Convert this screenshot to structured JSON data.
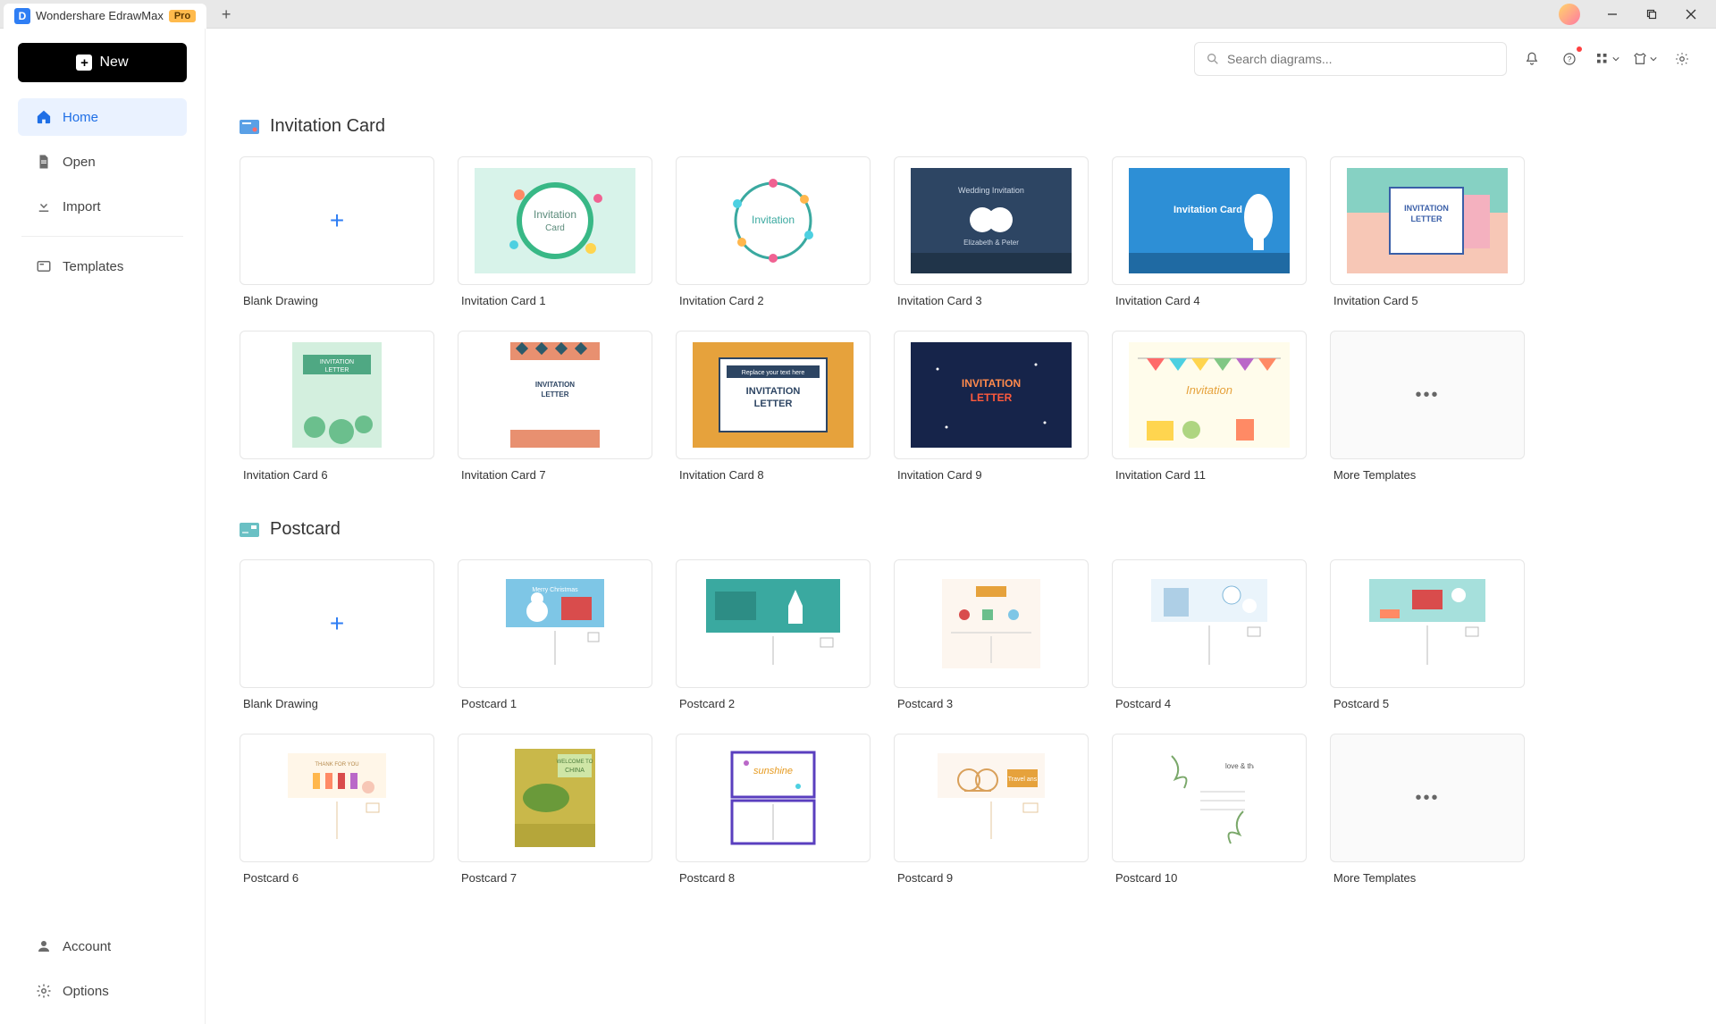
{
  "app": {
    "name": "Wondershare EdrawMax",
    "badge": "Pro"
  },
  "sidebar": {
    "new_label": "New",
    "items": [
      {
        "label": "Home"
      },
      {
        "label": "Open"
      },
      {
        "label": "Import"
      },
      {
        "label": "Templates"
      }
    ],
    "footer": [
      {
        "label": "Account"
      },
      {
        "label": "Options"
      }
    ]
  },
  "search": {
    "placeholder": "Search diagrams..."
  },
  "sections": [
    {
      "title": "Invitation Card",
      "cards": [
        {
          "label": "Blank Drawing"
        },
        {
          "label": "Invitation Card 1"
        },
        {
          "label": "Invitation Card 2"
        },
        {
          "label": "Invitation Card 3"
        },
        {
          "label": "Invitation Card 4"
        },
        {
          "label": "Invitation Card 5"
        },
        {
          "label": "Invitation Card 6"
        },
        {
          "label": "Invitation Card 7"
        },
        {
          "label": "Invitation Card 8"
        },
        {
          "label": "Invitation Card 9"
        },
        {
          "label": "Invitation Card 11"
        },
        {
          "label": "More Templates"
        }
      ]
    },
    {
      "title": "Postcard",
      "cards": [
        {
          "label": "Blank Drawing"
        },
        {
          "label": "Postcard 1"
        },
        {
          "label": "Postcard 2"
        },
        {
          "label": "Postcard 3"
        },
        {
          "label": "Postcard 4"
        },
        {
          "label": "Postcard 5"
        },
        {
          "label": "Postcard 6"
        },
        {
          "label": "Postcard 7"
        },
        {
          "label": "Postcard 8"
        },
        {
          "label": "Postcard 9"
        },
        {
          "label": "Postcard 10"
        },
        {
          "label": "More Templates"
        }
      ]
    }
  ]
}
